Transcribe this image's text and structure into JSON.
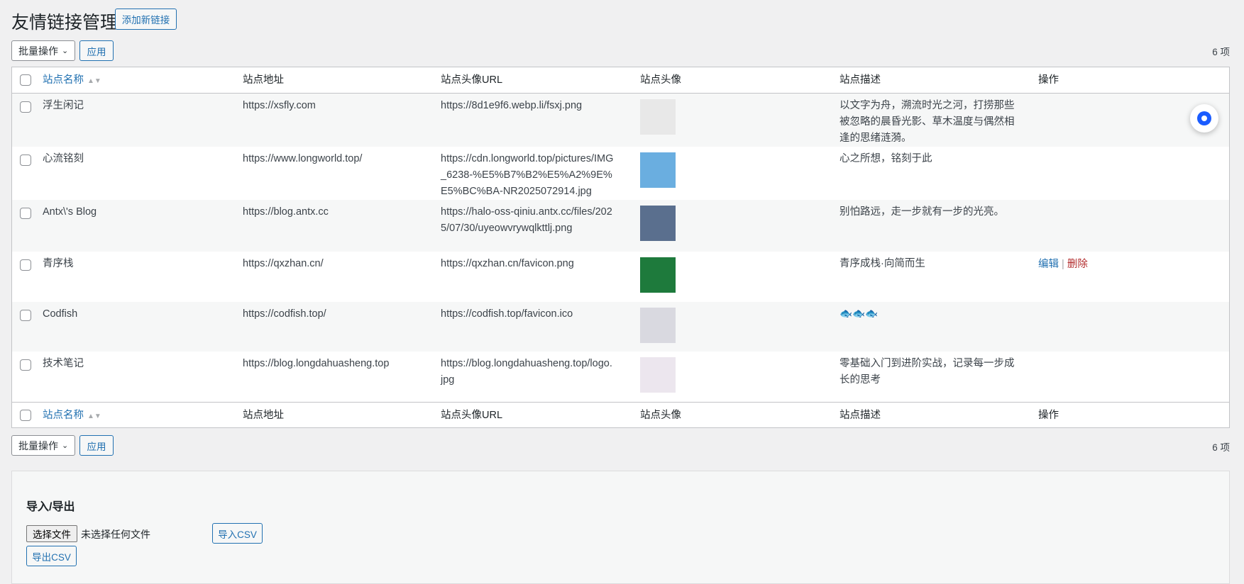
{
  "page": {
    "title": "友情链接管理",
    "add_new": "添加新链接"
  },
  "bulk": {
    "label": "批量操作",
    "apply": "应用",
    "count": "6 项"
  },
  "columns": [
    "站点名称",
    "站点地址",
    "站点头像URL",
    "站点头像",
    "站点描述",
    "操作"
  ],
  "rows": [
    {
      "name": "浮生闲记",
      "url": "https://xsfly.com",
      "avatar_url": "https://8d1e9f6.webp.li/fsxj.png",
      "desc": "以文字为舟，溯流时光之河，打捞那些被忽略的晨昏光影、草木温度与偶然相逢的思绪涟漪。",
      "avatar_color": "#e8e8e8"
    },
    {
      "name": "心流铭刻",
      "url": "https://www.longworld.top/",
      "avatar_url": "https://cdn.longworld.top/pictures/IMG_6238-%E5%B7%B2%E5%A2%9E%E5%BC%BA-NR2025072914.jpg",
      "desc": "心之所想，铭刻于此",
      "avatar_color": "#6aaee0"
    },
    {
      "name": "Antx\\'s Blog",
      "url": "https://blog.antx.cc",
      "avatar_url": "https://halo-oss-qiniu.antx.cc/files/2025/07/30/uyeowvrywqlkttlj.png",
      "desc": "别怕路远，走一步就有一步的光亮。",
      "avatar_color": "#5a6f8e"
    },
    {
      "name": "青序栈",
      "url": "https://qxzhan.cn/",
      "avatar_url": "https://qxzhan.cn/favicon.png",
      "desc": "青序成栈·向简而生",
      "avatar_color": "#1e7a3c"
    },
    {
      "name": "Codfish",
      "url": "https://codfish.top/",
      "avatar_url": "https://codfish.top/favicon.ico",
      "desc": "🐟🐟🐟",
      "avatar_color": "#d9d9e0"
    },
    {
      "name": "技术笔记",
      "url": "https://blog.longdahuasheng.top",
      "avatar_url": "https://blog.longdahuasheng.top/logo.jpg",
      "desc": "零基础入门到进阶实战，记录每一步成长的思考",
      "avatar_color": "#ece6ee"
    }
  ],
  "actions": {
    "edit": "编辑",
    "sep": "|",
    "delete": "删除"
  },
  "import": {
    "title": "导入/导出",
    "choose": "选择文件",
    "no_file": "未选择任何文件",
    "import_btn": "导入CSV",
    "export_btn": "导出CSV"
  }
}
